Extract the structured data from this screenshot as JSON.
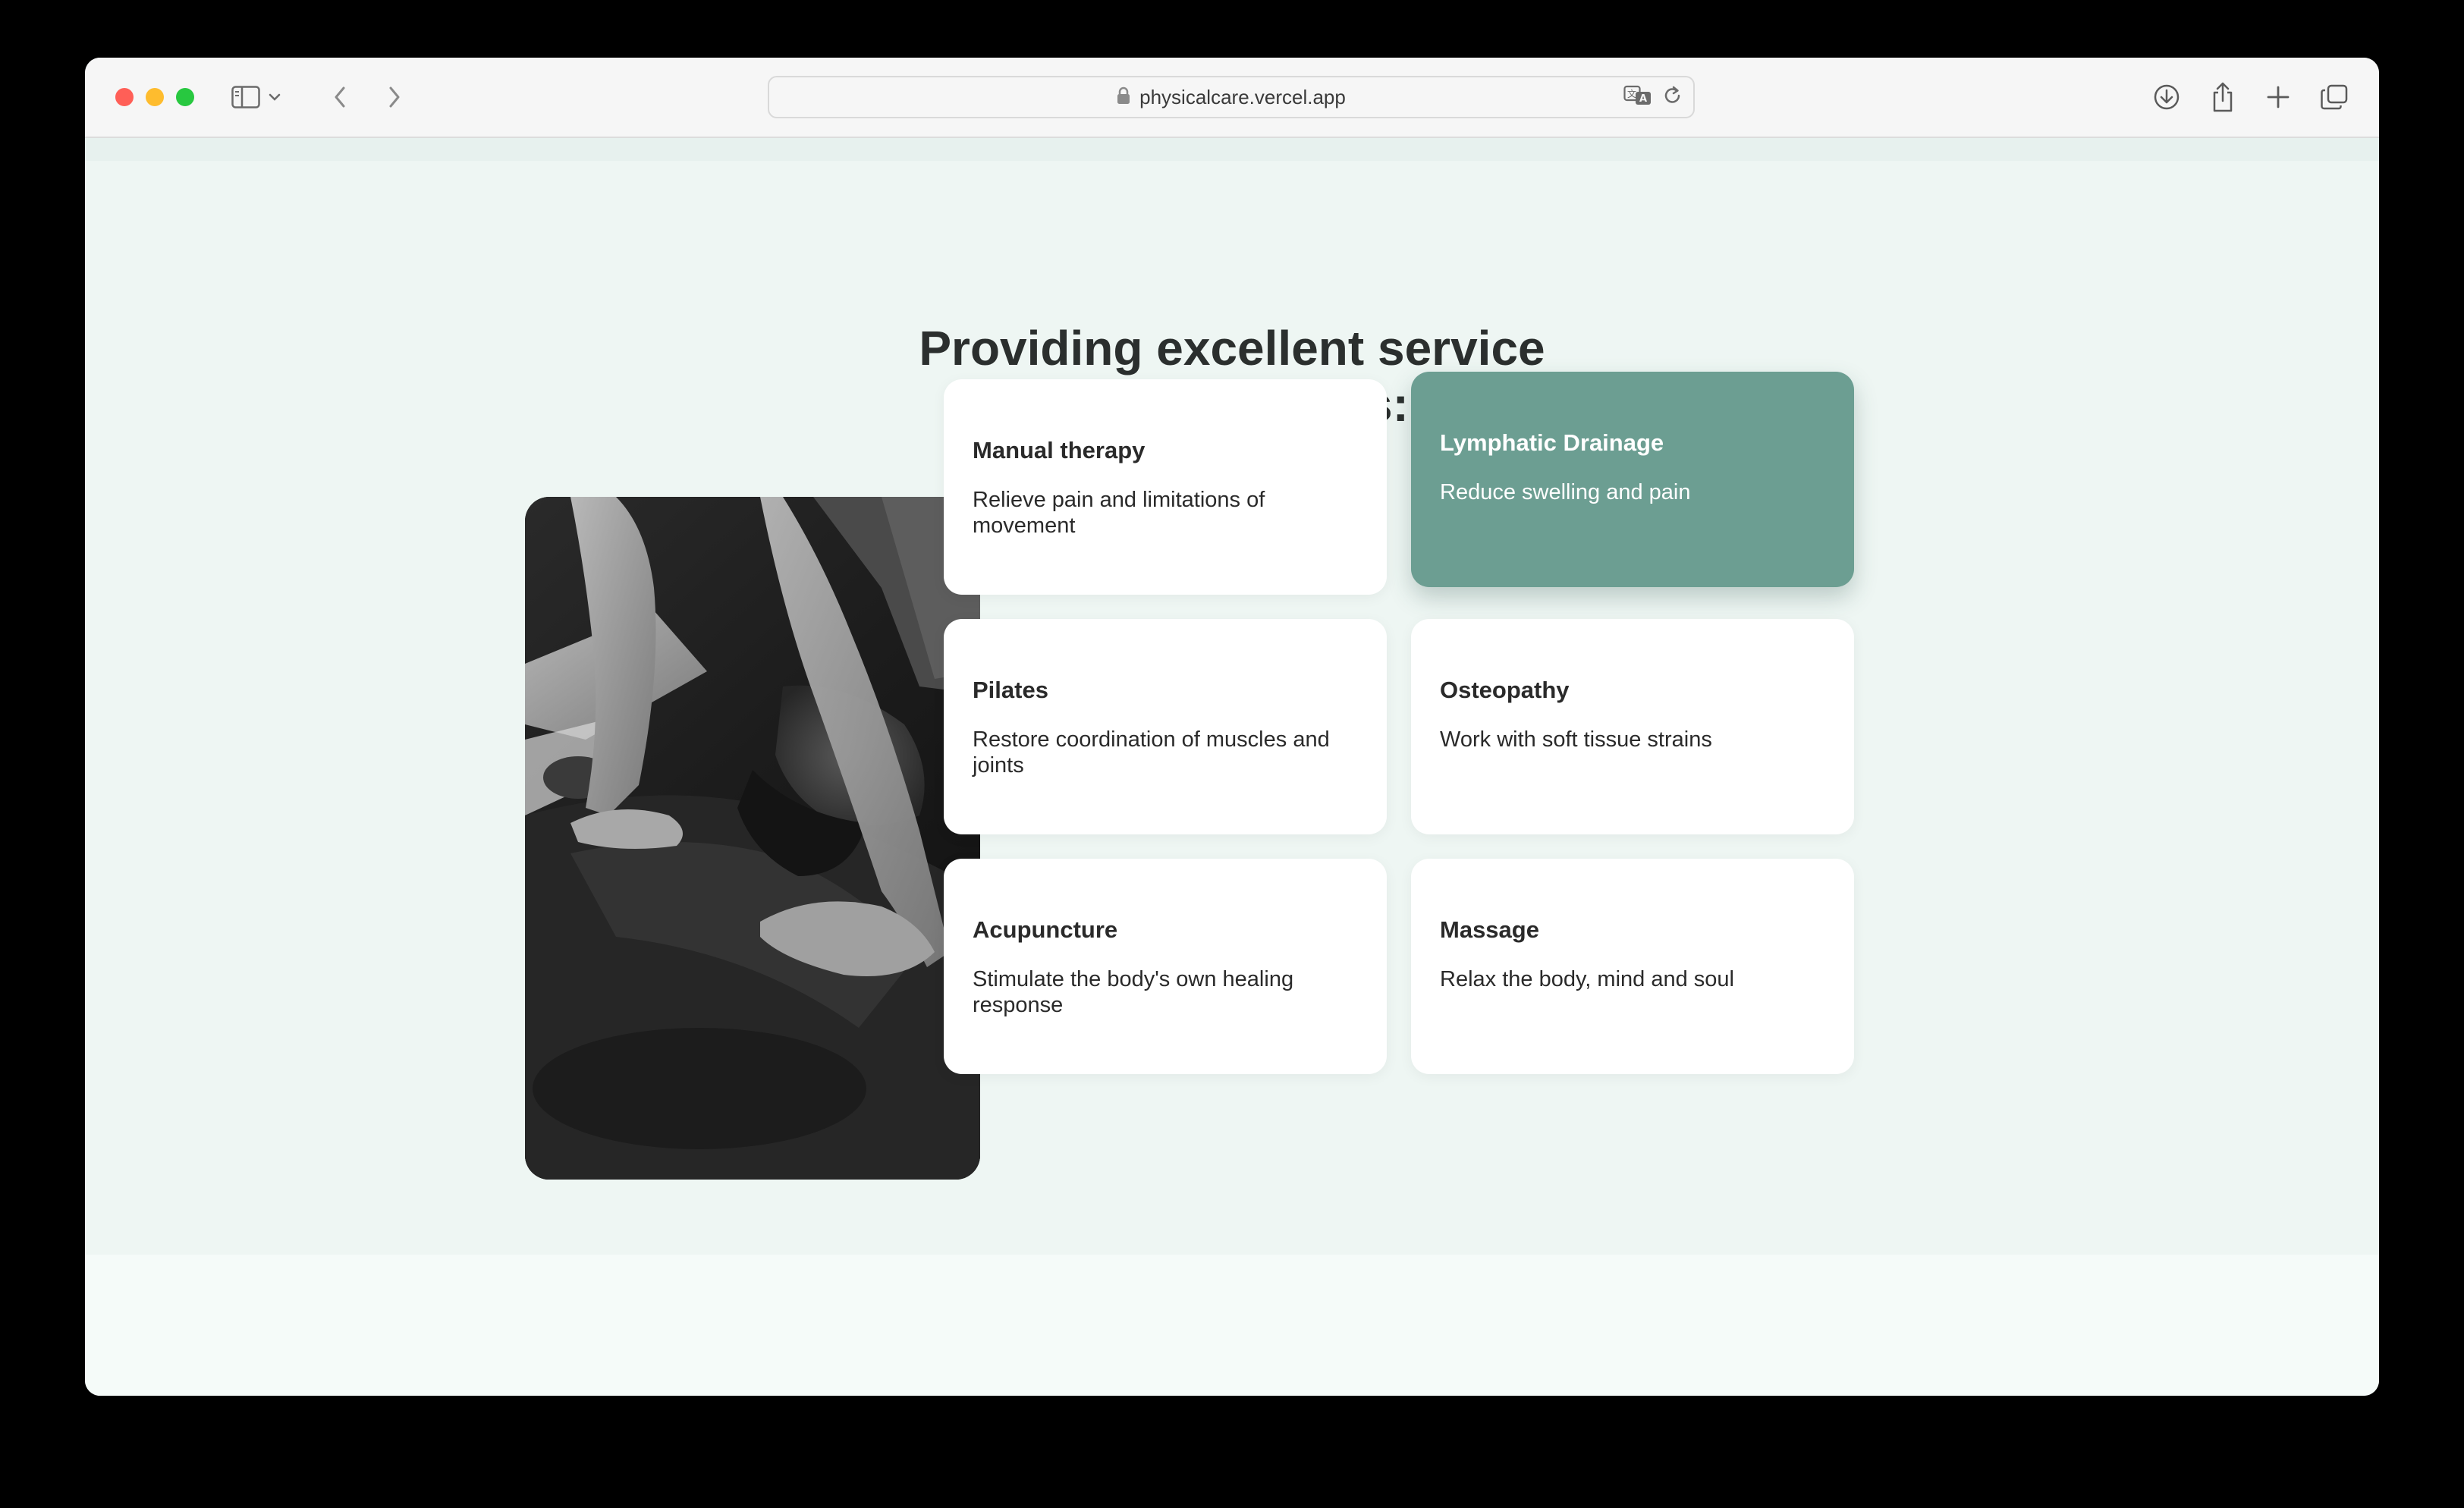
{
  "browser": {
    "url": "physicalcare.vercel.app",
    "icons": {
      "sidebar": "sidebar-icon",
      "back": "chevron-left-icon",
      "forward": "chevron-right-icon",
      "lock": "lock-icon",
      "translate": "translate-icon",
      "reload": "reload-icon",
      "download": "download-icon",
      "share": "share-icon",
      "new_tab": "plus-icon",
      "tabs": "tabs-overview-icon"
    },
    "traffic_colors": {
      "close": "#ff5f57",
      "minimize": "#febc2e",
      "maximize": "#28c840"
    }
  },
  "section": {
    "heading_line1": "Providing excellent service",
    "heading_line2": "to our patients:",
    "accent_color": "#6c9e92"
  },
  "services": [
    {
      "title": "Manual therapy",
      "description": "Relieve pain and limitations of movement",
      "active": false
    },
    {
      "title": "Lymphatic Drainage",
      "description": "Reduce swelling and pain",
      "active": true
    },
    {
      "title": "Pilates",
      "description": "Restore coordination of muscles and joints",
      "active": false
    },
    {
      "title": "Osteopathy",
      "description": "Work with soft tissue strains",
      "active": false
    },
    {
      "title": "Acupuncture",
      "description": "Stimulate the body's own healing response",
      "active": false
    },
    {
      "title": "Massage",
      "description": "Relax the body, mind and soul",
      "active": false
    }
  ]
}
